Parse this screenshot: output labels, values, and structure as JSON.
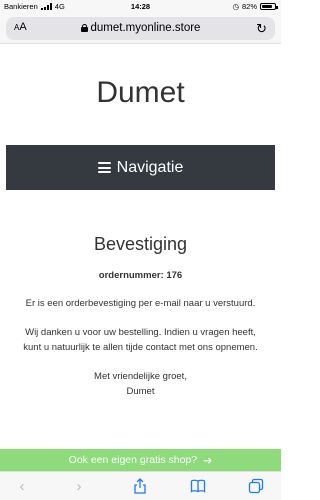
{
  "status_bar": {
    "carrier": "Bankieren",
    "network": "4G",
    "time": "14:28",
    "battery": "82%",
    "battery_level": 0.82
  },
  "browser": {
    "text_size_label": "AA",
    "url": "dumet.myonline.store"
  },
  "site": {
    "title": "Dumet"
  },
  "nav": {
    "label": "Navigatie"
  },
  "confirmation": {
    "heading": "Bevestiging",
    "order_number": "ordernummer: 176",
    "email_notice": "Er is een orderbevestiging per e-mail naar u verstuurd.",
    "thanks": "Wij danken u voor uw bestelling. Indien u vragen heeft, kunt u natuurlijk te allen tijde contact met ons opnemen.",
    "greeting": "Met vriendelijke groet,",
    "signature": "Dumet"
  },
  "promo": {
    "label": "Ook een eigen gratis shop?",
    "color": "#8ddb7a"
  },
  "colors": {
    "nav_background": "#343a40",
    "safari_blue": "#1b7cf5"
  }
}
